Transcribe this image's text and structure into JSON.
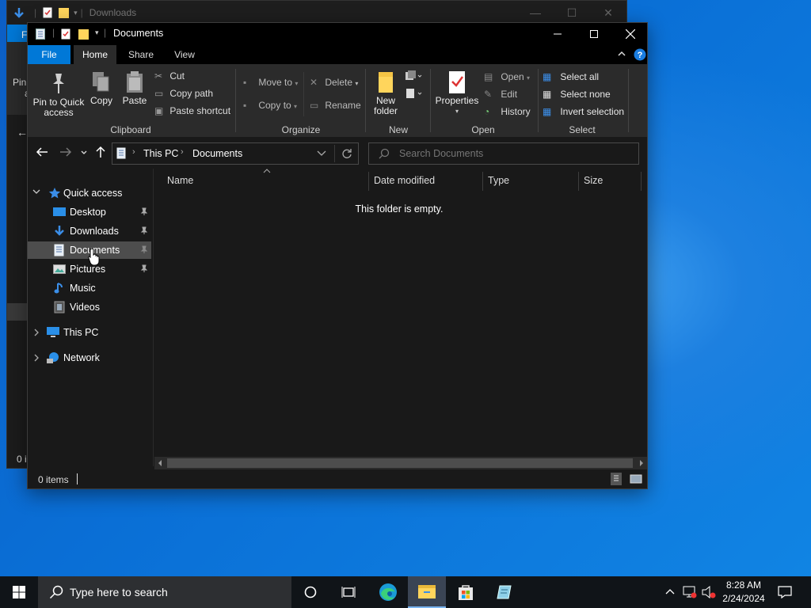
{
  "background_window": {
    "title": "Downloads",
    "side_label_1": "Pin",
    "side_label_2": "a",
    "side_label_status": "0 i",
    "side_label_tab": "F"
  },
  "window": {
    "title": "Documents",
    "tabs": [
      "File",
      "Home",
      "Share",
      "View"
    ],
    "active_tab": "Home"
  },
  "ribbon": {
    "clipboard": {
      "pin_to_quick_access": "Pin to Quick access",
      "copy": "Copy",
      "paste": "Paste",
      "cut": "Cut",
      "copy_path": "Copy path",
      "paste_shortcut": "Paste shortcut",
      "group": "Clipboard"
    },
    "organize": {
      "move_to": "Move to",
      "copy_to": "Copy to",
      "delete": "Delete",
      "rename": "Rename",
      "group": "Organize"
    },
    "new": {
      "new_folder": "New folder",
      "group": "New"
    },
    "open": {
      "properties": "Properties",
      "open": "Open",
      "edit": "Edit",
      "history": "History",
      "group": "Open"
    },
    "select": {
      "select_all": "Select all",
      "select_none": "Select none",
      "invert_selection": "Invert selection",
      "group": "Select"
    }
  },
  "address": {
    "crumbs": [
      "This PC",
      "Documents"
    ]
  },
  "search": {
    "placeholder": "Search Documents"
  },
  "nav": {
    "quick_access": "Quick access",
    "items": [
      "Desktop",
      "Downloads",
      "Documents",
      "Pictures",
      "Music",
      "Videos"
    ],
    "this_pc": "This PC",
    "network": "Network"
  },
  "columns": [
    "Name",
    "Date modified",
    "Type",
    "Size"
  ],
  "empty_message": "This folder is empty.",
  "status": {
    "items": "0 items"
  },
  "taskbar": {
    "search_placeholder": "Type here to search",
    "time": "8:28 AM",
    "date": "2/24/2024"
  },
  "colors": {
    "accent": "#0078d7",
    "selection": "#4d4d4d",
    "ribbon": "#2b2b2b",
    "window_bg": "#191919"
  }
}
